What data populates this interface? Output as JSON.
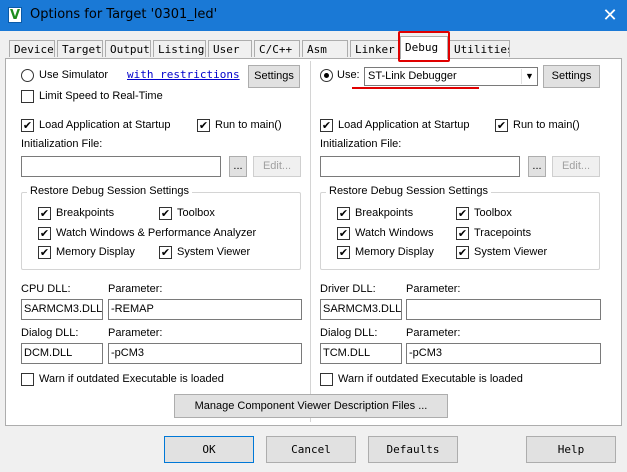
{
  "window": {
    "title": "Options for Target '0301_led'",
    "app_icon_glyph": "V",
    "close_glyph": "✕"
  },
  "tabs": [
    "Device",
    "Target",
    "Output",
    "Listing",
    "User",
    "C/C++",
    "Asm",
    "Linker",
    "Debug",
    "Utilities"
  ],
  "active_tab": "Debug",
  "left": {
    "use_simulator_label": "Use Simulator",
    "use_simulator_selected": false,
    "restrictions_link": "with restrictions",
    "settings_button": "Settings",
    "limit_speed_label": "Limit Speed to Real-Time",
    "limit_speed_checked": false,
    "load_app_label": "Load Application at Startup",
    "load_app_checked": true,
    "run_main_label": "Run to main()",
    "run_main_checked": true,
    "init_file_label": "Initialization File:",
    "init_file_value": "",
    "browse_button": "...",
    "edit_button": "Edit...",
    "restore_group_title": "Restore Debug Session Settings",
    "restore": {
      "breakpoints": "Breakpoints",
      "toolbox": "Toolbox",
      "watch": "Watch Windows & Performance Analyzer",
      "memory": "Memory Display",
      "system_viewer": "System Viewer"
    },
    "cpu_dll_label": "CPU DLL:",
    "cpu_dll_value": "SARMCM3.DLL",
    "cpu_param_label": "Parameter:",
    "cpu_param_value": "-REMAP",
    "dialog_dll_label": "Dialog DLL:",
    "dialog_dll_value": "DCM.DLL",
    "dialog_param_label": "Parameter:",
    "dialog_param_value": "-pCM3",
    "warn_label": "Warn if outdated Executable is loaded",
    "warn_checked": false
  },
  "right": {
    "use_label": "Use:",
    "use_selected": true,
    "debugger_value": "ST-Link Debugger",
    "settings_button": "Settings",
    "load_app_label": "Load Application at Startup",
    "load_app_checked": true,
    "run_main_label": "Run to main()",
    "run_main_checked": true,
    "init_file_label": "Initialization File:",
    "init_file_value": "",
    "browse_button": "...",
    "edit_button": "Edit...",
    "restore_group_title": "Restore Debug Session Settings",
    "restore": {
      "breakpoints": "Breakpoints",
      "toolbox": "Toolbox",
      "watch": "Watch Windows",
      "tracepoints": "Tracepoints",
      "memory": "Memory Display",
      "system_viewer": "System Viewer"
    },
    "driver_dll_label": "Driver DLL:",
    "driver_dll_value": "SARMCM3.DLL",
    "driver_param_label": "Parameter:",
    "driver_param_value": "",
    "dialog_dll_label": "Dialog DLL:",
    "dialog_dll_value": "TCM.DLL",
    "dialog_param_label": "Parameter:",
    "dialog_param_value": "-pCM3",
    "warn_label": "Warn if outdated Executable is loaded",
    "warn_checked": false
  },
  "manage_button": "Manage Component Viewer Description Files ...",
  "buttons": {
    "ok": "OK",
    "cancel": "Cancel",
    "defaults": "Defaults",
    "help": "Help"
  },
  "colors": {
    "titlebar": "#1a79d6",
    "highlight": "#e00000",
    "link": "#0000cc"
  },
  "check_glyph": "✔"
}
